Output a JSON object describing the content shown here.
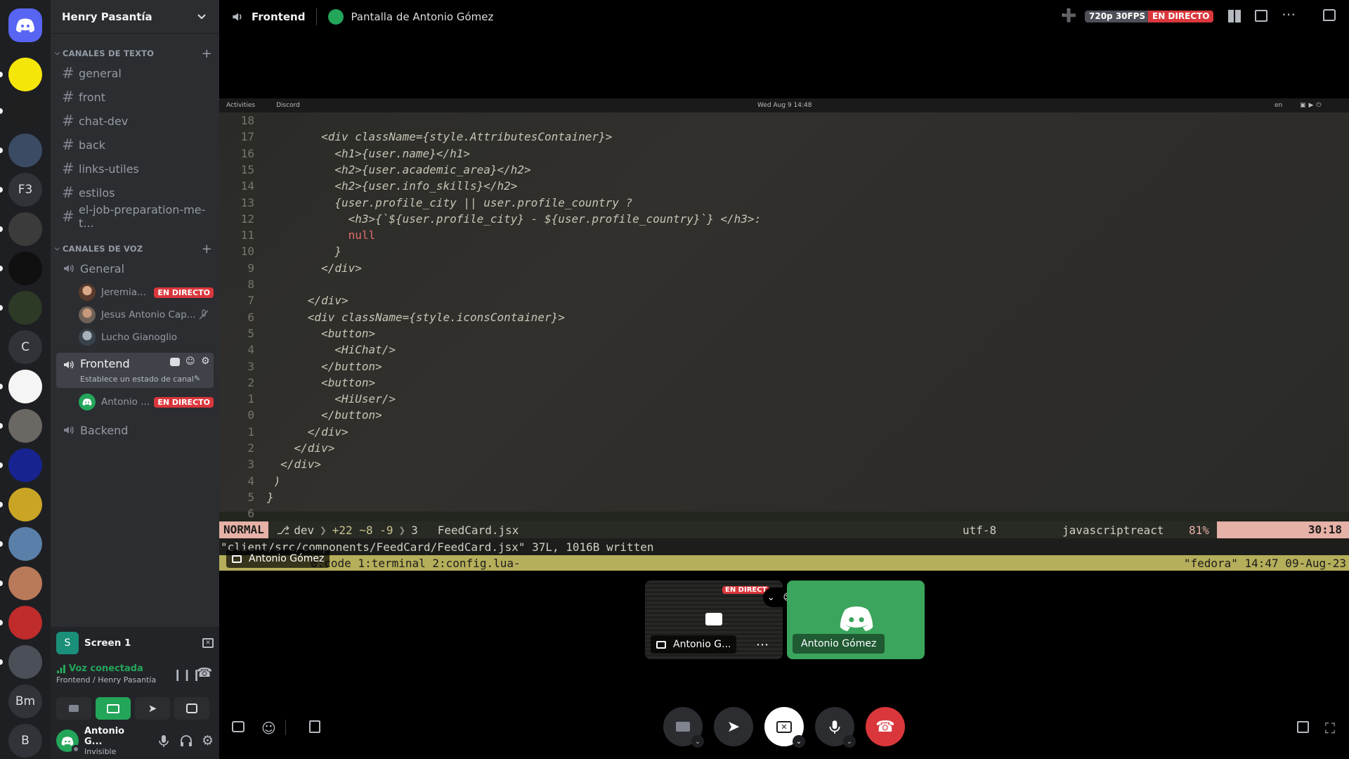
{
  "servers": [
    {
      "label": "",
      "icon": "discord-logo-icon"
    },
    {
      "label": "",
      "icon": "henry-server-icon"
    },
    {
      "label": "",
      "icon": "code-server-icon"
    },
    {
      "label": "",
      "icon": "server-icon"
    },
    {
      "label": "F3",
      "icon": ""
    },
    {
      "label": "",
      "icon": "server-icon"
    },
    {
      "label": "",
      "icon": "server-icon"
    },
    {
      "label": "",
      "icon": "server-icon"
    },
    {
      "label": "C",
      "icon": ""
    },
    {
      "label": "",
      "icon": "server-icon"
    },
    {
      "label": "",
      "icon": "server-icon"
    },
    {
      "label": "",
      "icon": "server-icon"
    },
    {
      "label": "",
      "icon": "server-icon"
    },
    {
      "label": "",
      "icon": "server-icon"
    },
    {
      "label": "",
      "icon": "server-icon"
    },
    {
      "label": "",
      "icon": "server-icon"
    },
    {
      "label": "",
      "icon": "server-icon"
    },
    {
      "label": "Bm",
      "icon": ""
    },
    {
      "label": "B",
      "icon": ""
    }
  ],
  "guild": {
    "name": "Henry Pasantía"
  },
  "text_category": "CANALES DE TEXTO",
  "text_channels": [
    "general",
    "front",
    "chat-dev",
    "back",
    "links-utiles",
    "estilos",
    "el-job-preparation-me-t..."
  ],
  "voice_category": "CANALES DE VOZ",
  "voice_channels": {
    "general": {
      "name": "General",
      "users": [
        {
          "name": "Jeremia...",
          "live": "EN DIRECTO"
        },
        {
          "name": "Jesus Antonio Cap...",
          "live": ""
        },
        {
          "name": "Lucho Gianoglio",
          "live": ""
        }
      ]
    },
    "frontend": {
      "name": "Frontend",
      "status": "Establece un estado de canal",
      "users": [
        {
          "name": "Antonio ...",
          "live": "EN DIRECTO"
        }
      ]
    },
    "backend": {
      "name": "Backend"
    }
  },
  "screen_panel": {
    "badge": "S",
    "title": "Screen 1"
  },
  "voice_connected": {
    "status": "Voz conectada",
    "location": "Frontend / Henry Pasantía"
  },
  "user": {
    "name": "Antonio G...",
    "status": "Invisible"
  },
  "topbar": {
    "channel": "Frontend",
    "stream_title": "Pantalla de Antonio Gómez",
    "quality": "720p 30FPS",
    "live": "EN DIRECTO"
  },
  "stream": {
    "gnome": {
      "activities": "Activities",
      "app": "Discord",
      "clock": "Wed Aug 9  14:48",
      "lang": "en"
    },
    "code_lines": [
      {
        "n": "18",
        "t": ""
      },
      {
        "n": "17",
        "t": "        <div className={style.AttributesContainer}>"
      },
      {
        "n": "16",
        "t": "          <h1>{user.name}</h1>"
      },
      {
        "n": "15",
        "t": "          <h2>{user.academic_area}</h2>"
      },
      {
        "n": "14",
        "t": "          <h2>{user.info_skills}</h2>"
      },
      {
        "n": "13",
        "t": "          {user.profile_city || user.profile_country ?"
      },
      {
        "n": "12",
        "t": "            <h3>{`${user.profile_city} - ${user.profile_country}`} </h3>:"
      },
      {
        "n": "11",
        "t": "            null"
      },
      {
        "n": "10",
        "t": "          }"
      },
      {
        "n": "9",
        "t": "        </div>"
      },
      {
        "n": "8",
        "t": ""
      },
      {
        "n": "7",
        "t": "      </div>"
      },
      {
        "n": "6",
        "t": "      <div className={style.iconsContainer}>"
      },
      {
        "n": "5",
        "t": "        <button>"
      },
      {
        "n": "4",
        "t": "          <HiChat/>"
      },
      {
        "n": "3",
        "t": "        </button>"
      },
      {
        "n": "2",
        "t": "        <button>"
      },
      {
        "n": "1",
        "t": "          <HiUser/>"
      },
      {
        "n": "0",
        "t": "        </button>"
      },
      {
        "n": "1",
        "t": "      </div>"
      },
      {
        "n": "2",
        "t": "    </div>"
      },
      {
        "n": "3",
        "t": "  </div>"
      },
      {
        "n": "4",
        "t": " )"
      },
      {
        "n": "5",
        "t": "}"
      },
      {
        "n": "6",
        "t": ""
      }
    ],
    "status": {
      "mode": "NORMAL",
      "branch": "dev",
      "diff": "+22 ~8 -9",
      "count": "3",
      "file": "FeedCard.jsx",
      "encoding": "utf-8",
      "filetype": "javascriptreact",
      "percent": "81%",
      "position": "30:18"
    },
    "message": "\"client/src/components/FeedCard/FeedCard.jsx\" 37L, 1016B written",
    "tmux": {
      "left": "0:code  1:terminal  2:config.lua-",
      "right": "\"fedora\" 14:47 09-Aug-23"
    },
    "owner_label": "Antonio Gómez"
  },
  "tiles": [
    {
      "name": "Antonio G...",
      "live": "EN DIRECT"
    },
    {
      "name": "Antonio Gómez"
    }
  ],
  "colors": {
    "accent": "#5865f2",
    "live": "#da373c",
    "green": "#23a55a",
    "tile_green": "#3ba55d"
  }
}
